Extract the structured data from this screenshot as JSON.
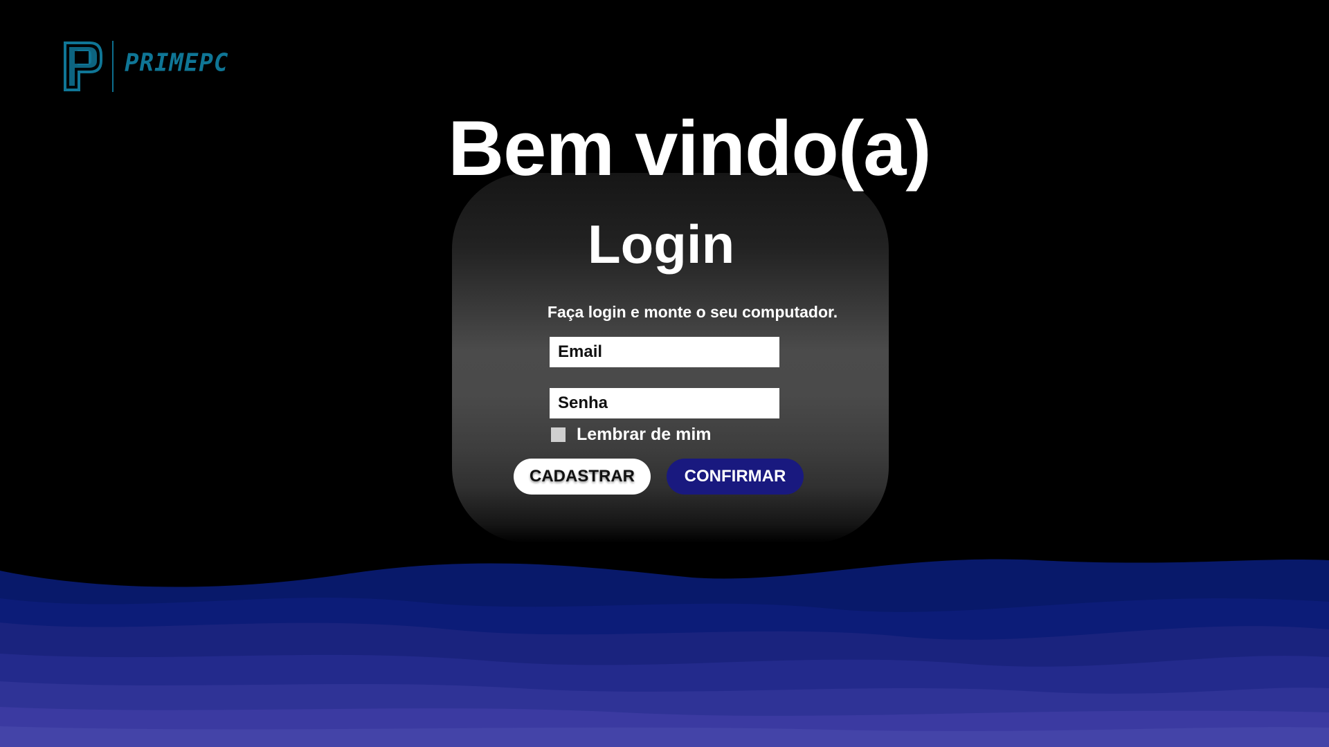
{
  "brand": {
    "logo_letter": "P",
    "logo_text": "PRIMEPC",
    "color": "#0f7696"
  },
  "welcome_title": "Bem vindo(a)",
  "login": {
    "title": "Login",
    "subtitle": "Faça login e monte o seu computador.",
    "email_placeholder": "Email",
    "password_placeholder": "Senha",
    "remember_label": "Lembrar de mim",
    "remember_checked": false,
    "register_label": "CADASTRAR",
    "confirm_label": "CONFIRMAR"
  },
  "colors": {
    "background": "#000000",
    "confirm_button": "#19197f",
    "wave_dark": "#0a1a6e",
    "wave_light": "#4646a8"
  }
}
